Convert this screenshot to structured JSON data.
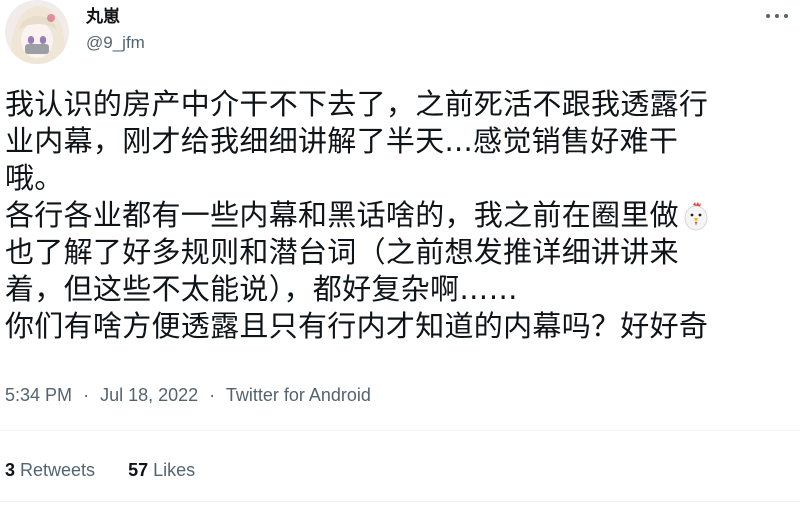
{
  "author": {
    "display_name": "丸崽",
    "handle": "@9_jfm",
    "avatar_icon": "anime-avatar-icon"
  },
  "more_icon": "more-horizontal-icon",
  "tweet": {
    "lines": [
      "我认识的房产中介干不下去了，之前死活不跟我透露行",
      "业内幕，刚才给我细细讲解了半天...感觉销售好难干",
      "哦。",
      "各行各业都有一些内幕和黑话啥的，我之前在圈里做",
      "也了解了好多规则和潜台词（之前想发推详细讲讲来",
      "着，但这些不太能说），都好复杂啊……",
      "你们有啥方便透露且只有行内才知道的内幕吗？好好奇"
    ],
    "emoji_icon": "chicken-emoji-icon"
  },
  "meta": {
    "time": "5:34 PM",
    "date": "Jul 18, 2022",
    "separator": "·",
    "source": "Twitter for Android"
  },
  "stats": {
    "retweets_count": "3",
    "retweets_label": "Retweets",
    "likes_count": "57",
    "likes_label": "Likes"
  },
  "colors": {
    "text": "#0f1419",
    "secondary": "#536471",
    "divider": "#eff3f4"
  }
}
